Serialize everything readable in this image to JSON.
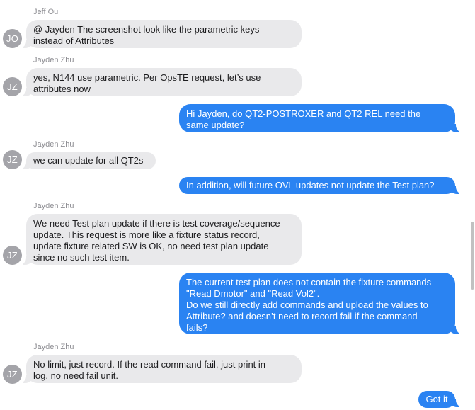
{
  "messages": [
    {
      "sender": "Jeff Ou",
      "initials": "JO",
      "direction": "in",
      "lines": [
        "@ Jayden The screenshot look like the parametric keys",
        "instead of Attributes"
      ]
    },
    {
      "sender": "Jayden Zhu",
      "initials": "JZ",
      "direction": "in",
      "lines": [
        "yes, N144 use parametric. Per OpsTE request, let’s use",
        "attributes now"
      ]
    },
    {
      "direction": "out",
      "lines": [
        "Hi Jayden, do QT2-POSTROXER and QT2 REL need the",
        "same update?"
      ]
    },
    {
      "sender": "Jayden Zhu",
      "initials": "JZ",
      "direction": "in",
      "lines": [
        "we can update for all QT2s"
      ]
    },
    {
      "direction": "out",
      "lines": [
        "In addition, will future OVL updates not update the Test plan?"
      ]
    },
    {
      "sender": "Jayden Zhu",
      "initials": "JZ",
      "direction": "in",
      "lines": [
        "We need Test plan update if there is test coverage/sequence",
        "update. This request is more like a fixture status record,",
        "update fixture related SW is OK, no need test plan update",
        "since no such test item."
      ]
    },
    {
      "direction": "out",
      "lines": [
        "The current test plan does not contain the fixture commands",
        "\"Read Dmotor\" and \"Read Vol2\".",
        "Do we still directly add commands and upload the values to",
        "Attribute? and doesn’t need to record fail if the command",
        "fails?"
      ]
    },
    {
      "sender": "Jayden Zhu",
      "initials": "JZ",
      "direction": "in",
      "lines": [
        "No limit, just record. If the read command fail, just print in",
        "log, no need fail unit."
      ]
    },
    {
      "direction": "out",
      "lines": [
        "Got it"
      ]
    }
  ],
  "colors": {
    "incoming_bubble": "#e9e9eb",
    "outgoing_bubble": "#2a83f2",
    "avatar": "#a4a4a9",
    "sender_name": "#8e8e93"
  }
}
